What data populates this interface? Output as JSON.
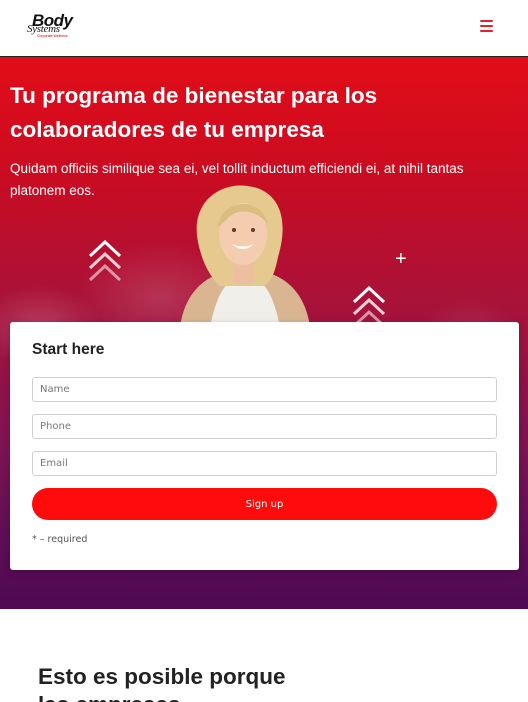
{
  "header": {
    "logo": {
      "word": "Body",
      "sub": "Systems",
      "corp": "Corporate Wellness"
    },
    "menu_icon": "hamburger-menu-icon"
  },
  "hero": {
    "title": "Tu programa de bienestar para los colaboradores de tu empresa",
    "text": "Quidam officiis similique sea ei, vel tollit inductum efficiendi ei, at nihil tantas platonem eos."
  },
  "form": {
    "title": "Start here",
    "name_placeholder": "Name",
    "phone_placeholder": "Phone",
    "email_placeholder": "Email",
    "submit_label": "Sign up",
    "required_note": "* – required"
  },
  "section": {
    "title": "Esto es posible porque las empresas"
  },
  "colors": {
    "accent": "#ff0b0b",
    "hero_top": "#e20d18",
    "hero_bottom": "#4d0a52",
    "menu": "#e3222c"
  }
}
